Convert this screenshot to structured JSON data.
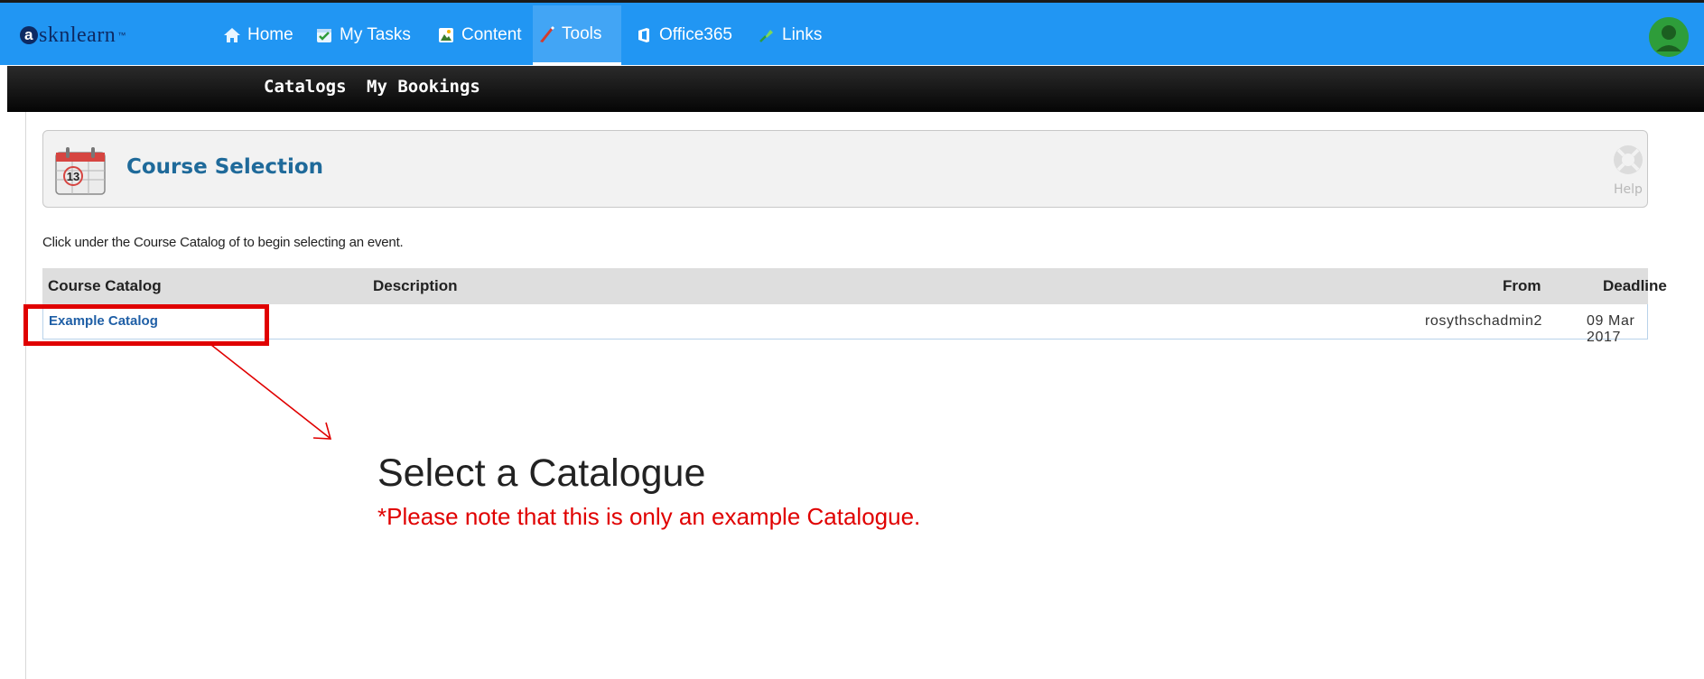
{
  "brand": {
    "logo_letter": "a",
    "logo_text": "sknlearn",
    "logo_mark": "™"
  },
  "topnav": {
    "items": [
      {
        "label": "Home",
        "icon": "home-icon"
      },
      {
        "label": "My Tasks",
        "icon": "tasks-icon"
      },
      {
        "label": "Content",
        "icon": "content-icon"
      },
      {
        "label": "Tools",
        "icon": "tools-icon",
        "active": true
      },
      {
        "label": "Office365",
        "icon": "office365-icon"
      },
      {
        "label": "Links",
        "icon": "links-icon"
      }
    ]
  },
  "subnav": {
    "items": [
      "Catalogs",
      "My Bookings"
    ]
  },
  "header": {
    "title": "Course Selection",
    "calendar_day": "13",
    "help_label": "Help"
  },
  "instruction": "Click under the Course Catalog of to begin selecting an event.",
  "table": {
    "columns": [
      "Course Catalog",
      "Description",
      "From",
      "Deadline"
    ],
    "rows": [
      {
        "catalog": "Example Catalog",
        "description": "",
        "from": "rosythschadmin2",
        "deadline": "09 Mar 2017"
      }
    ]
  },
  "annotation": {
    "title": "Select a Catalogue",
    "note": "*Please note that this is only an example Catalogue."
  },
  "colors": {
    "topnav_bg": "#2196f3",
    "subnav_bg": "#111111",
    "title_blue": "#1f6a9a",
    "link_blue": "#1f5fa6",
    "annotation_red": "#e00000"
  }
}
